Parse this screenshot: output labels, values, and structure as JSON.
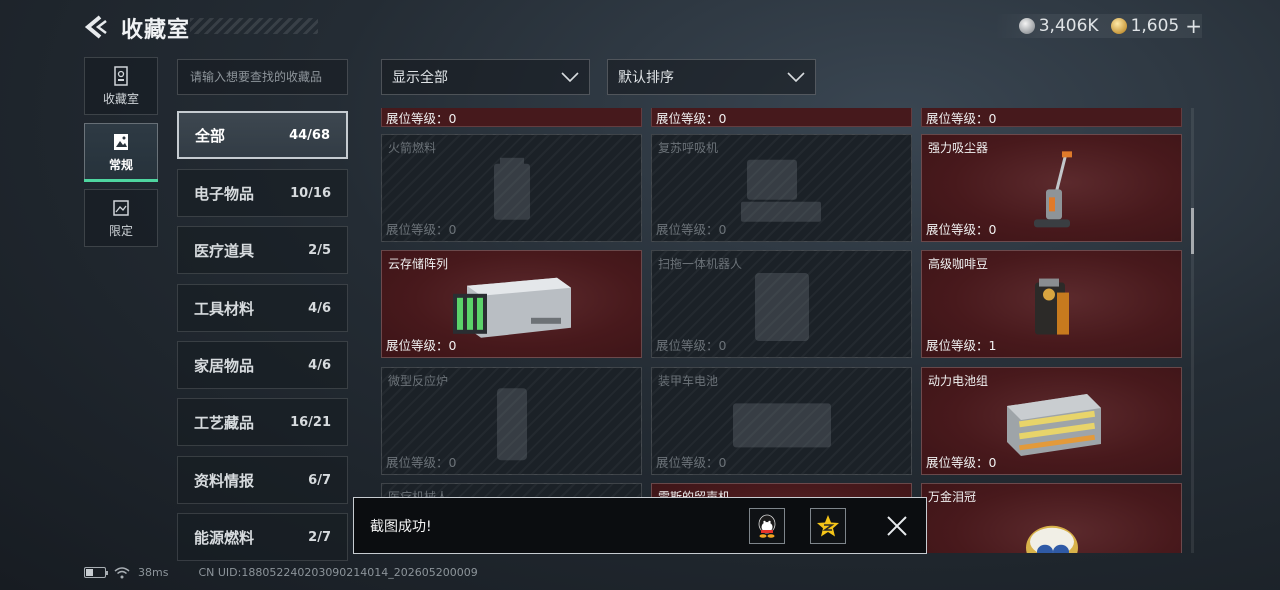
{
  "header": {
    "title": "收藏室",
    "currencies": [
      {
        "icon": "silver-coin-icon",
        "value": "3,406K"
      },
      {
        "icon": "gold-coin-icon",
        "value": "1,605"
      }
    ],
    "plus": "+"
  },
  "side_tabs": [
    {
      "label": "收藏室",
      "icon": "collection-room-icon",
      "active": false
    },
    {
      "label": "常规",
      "icon": "regular-icon",
      "active": true
    },
    {
      "label": "限定",
      "icon": "limited-icon",
      "active": false
    }
  ],
  "search": {
    "placeholder": "请输入想要查找的收藏品"
  },
  "categories": [
    {
      "name": "全部",
      "count": "44/68",
      "active": true
    },
    {
      "name": "电子物品",
      "count": "10/16"
    },
    {
      "name": "医疗道具",
      "count": "2/5"
    },
    {
      "name": "工具材料",
      "count": "4/6"
    },
    {
      "name": "家居物品",
      "count": "4/6"
    },
    {
      "name": "工艺藏品",
      "count": "16/21"
    },
    {
      "name": "资料情报",
      "count": "6/7"
    },
    {
      "name": "能源燃料",
      "count": "2/7"
    }
  ],
  "filters": {
    "show": "显示全部",
    "sort": "默认排序"
  },
  "grid": {
    "top_strip_levels": [
      "展位等级：0",
      "展位等级：0",
      "展位等级：0"
    ],
    "items": [
      {
        "name": "火箭燃料",
        "level": "展位等级：0",
        "owned": false,
        "icon": "rocket-fuel-icon"
      },
      {
        "name": "复苏呼吸机",
        "level": "展位等级：0",
        "owned": false,
        "icon": "ventilator-icon"
      },
      {
        "name": "强力吸尘器",
        "level": "展位等级：0",
        "owned": true,
        "icon": "vacuum-cleaner-icon"
      },
      {
        "name": "云存储阵列",
        "level": "展位等级：0",
        "owned": true,
        "icon": "cloud-storage-array-icon"
      },
      {
        "name": "扫拖一体机器人",
        "level": "展位等级：0",
        "owned": false,
        "icon": "mop-robot-icon"
      },
      {
        "name": "高级咖啡豆",
        "level": "展位等级：1",
        "owned": true,
        "icon": "coffee-beans-icon"
      },
      {
        "name": "微型反应炉",
        "level": "展位等级：0",
        "owned": false,
        "icon": "micro-reactor-icon"
      },
      {
        "name": "装甲车电池",
        "level": "展位等级：0",
        "owned": false,
        "icon": "armored-battery-icon"
      },
      {
        "name": "动力电池组",
        "level": "展位等级：0",
        "owned": true,
        "icon": "power-battery-pack-icon"
      },
      {
        "name": "医疗机械人",
        "level": "",
        "owned": false,
        "icon": "medical-robot-icon"
      },
      {
        "name": "雷斯的留声机",
        "level": "",
        "owned": true,
        "icon": "phonograph-icon"
      },
      {
        "name": "万金泪冠",
        "level": "",
        "owned": true,
        "icon": "jeweled-egg-icon"
      }
    ]
  },
  "toast": {
    "message": "截图成功!",
    "share_icons": [
      "qq-icon",
      "qzone-icon"
    ]
  },
  "footer": {
    "ping": "38ms",
    "uid": "CN UID:188052240203090214014_202605200009"
  },
  "colors": {
    "accent_green": "#4fd6a0",
    "owned_card": "#4a1a1d"
  }
}
